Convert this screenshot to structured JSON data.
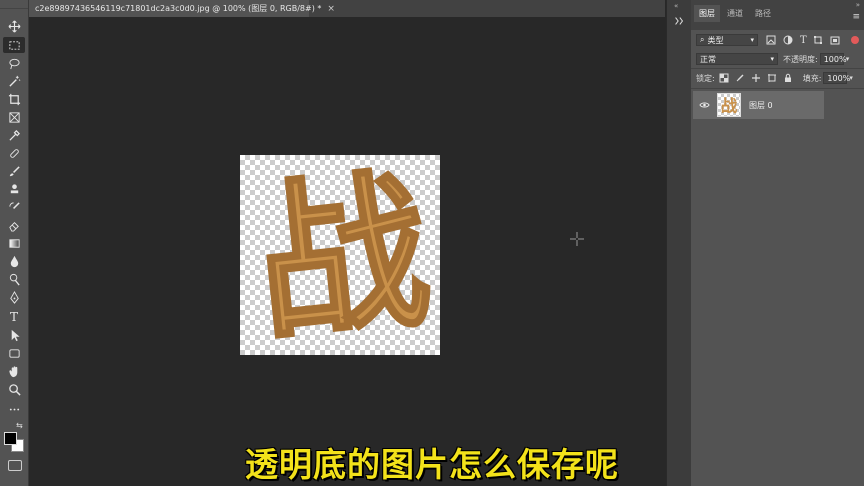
{
  "document_tab": {
    "title": "c2e89897436546119c71801dc2a3c0d0.jpg @ 100% (图层 0, RGB/8#) *",
    "close": "×"
  },
  "glyph": "战",
  "colors": {
    "glyph": "#c9914a",
    "glyph_dark": "#a46f33",
    "subtitle": "#f3e21a"
  },
  "tools": [
    "move-icon",
    "marquee-icon",
    "lasso-icon",
    "magic-wand-icon",
    "crop-icon",
    "frame-icon",
    "eyedropper-icon",
    "healing-brush-icon",
    "brush-icon",
    "clone-stamp-icon",
    "history-brush-icon",
    "eraser-icon",
    "gradient-icon",
    "blur-icon",
    "dodge-icon",
    "pen-icon",
    "type-icon",
    "path-select-icon",
    "shape-icon",
    "hand-icon",
    "zoom-icon",
    "more-icon"
  ],
  "tool_type_label": "T",
  "layers_panel": {
    "tabs": [
      "图层",
      "通道",
      "路径"
    ],
    "kind_filter": "类型",
    "blend_mode": "正常",
    "opacity_label": "不透明度:",
    "opacity_value": "100%",
    "lock_label": "锁定:",
    "fill_label": "填充:",
    "fill_value": "100%",
    "layer_name": "图层 0"
  },
  "subtitle": "透明底的图片怎么保存呢"
}
